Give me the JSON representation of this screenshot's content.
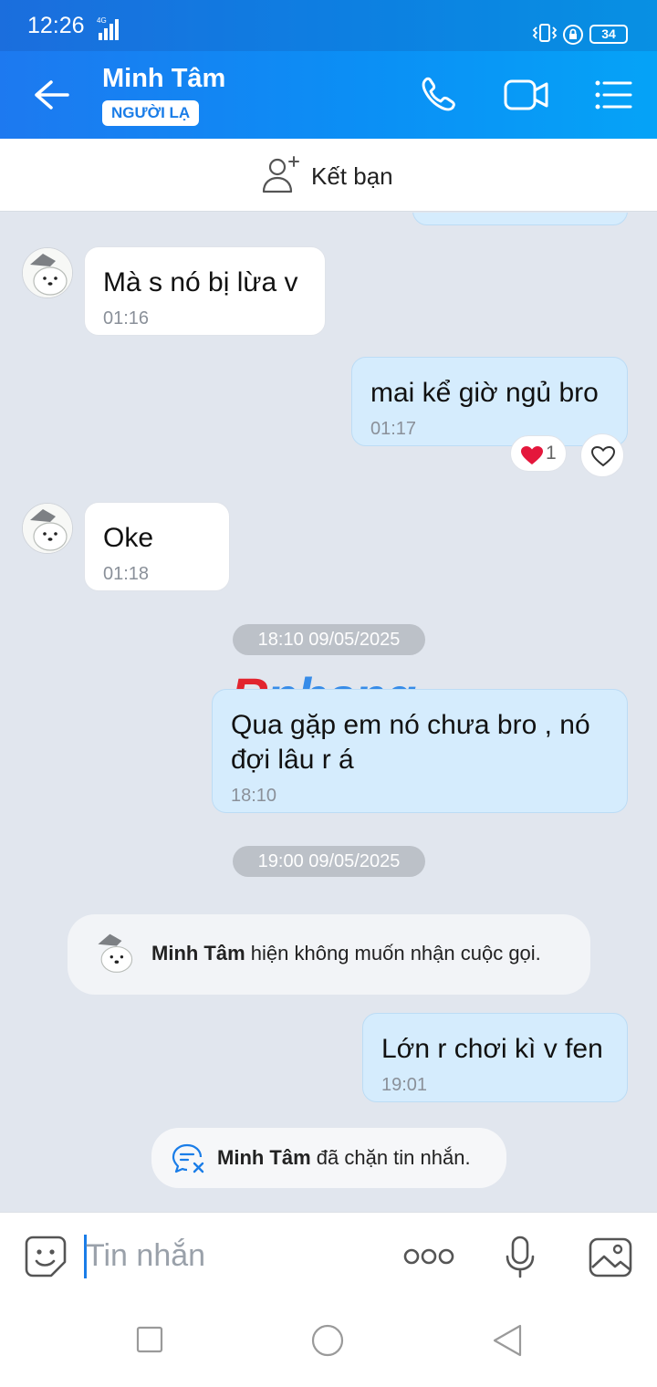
{
  "status_bar": {
    "time": "12:26",
    "network": "4G",
    "battery": "34"
  },
  "header": {
    "contact_name": "Minh Tâm",
    "badge": "NGƯỜI LẠ"
  },
  "add_friend": {
    "label": "Kết bạn"
  },
  "messages": [
    {
      "text": "Mà s nó bị lừa v",
      "time": "01:16",
      "direction": "incoming"
    },
    {
      "text": "mai kể giờ ngủ bro",
      "time": "01:17",
      "direction": "outgoing",
      "reaction_count": "1"
    },
    {
      "text": "Oke",
      "time": "01:18",
      "direction": "incoming"
    },
    {
      "date": "18:10 09/05/2025"
    },
    {
      "text": "Qua gặp em nó chưa bro , nó đợi lâu r á",
      "time": "18:10",
      "direction": "outgoing"
    },
    {
      "date": "19:00 09/05/2025"
    },
    {
      "system": {
        "name": "Minh Tâm",
        "text": " hiện không muốn nhận cuộc gọi."
      }
    },
    {
      "text": "Lớn r chơi kì v fen",
      "time": "19:01",
      "direction": "outgoing"
    },
    {
      "system": {
        "name": "Minh Tâm",
        "text": " đã chặn tin nhắn."
      }
    }
  ],
  "watermark": {
    "first": "R",
    "rest": "phang"
  },
  "composer": {
    "placeholder": "Tin nhắn"
  },
  "colors": {
    "header": "#1d79f0",
    "outgoing": "#d5ecfd",
    "incoming": "#ffffff",
    "chat_bg": "#e1e6ee"
  }
}
